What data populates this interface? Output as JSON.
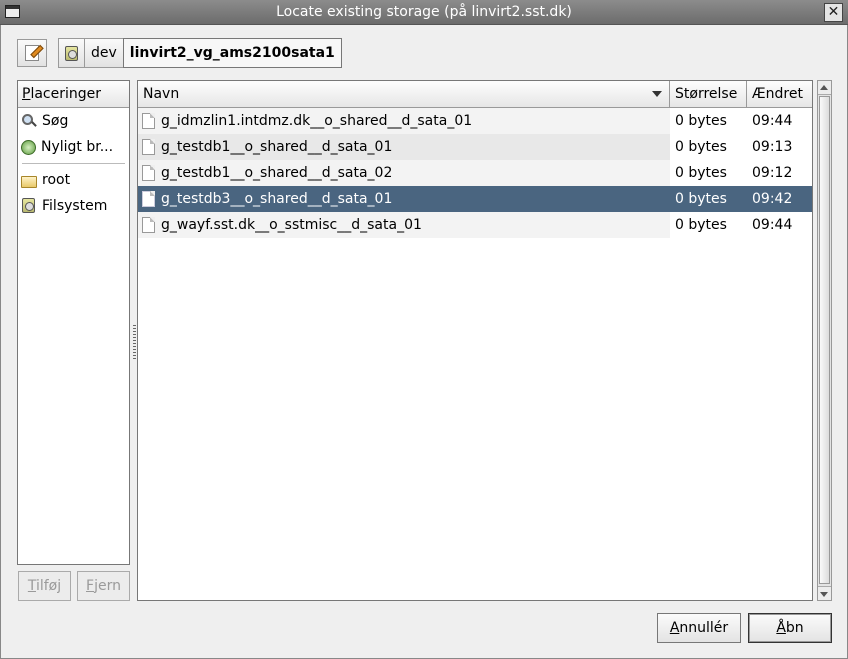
{
  "window": {
    "title": "Locate existing storage (på linvirt2.sst.dk)"
  },
  "path_bar": {
    "segments": [
      "dev",
      "linvirt2_vg_ams2100sata1"
    ]
  },
  "places": {
    "header_mnemonic": "P",
    "header_rest": "laceringer",
    "items": [
      {
        "label": "Søg",
        "icon": "search-icon"
      },
      {
        "label": "Nyligt br...",
        "icon": "recent-icon"
      },
      {
        "label": "root",
        "icon": "folder-icon"
      },
      {
        "label": "Filsystem",
        "icon": "drive-icon"
      }
    ],
    "add_button": {
      "mnemonic": "T",
      "rest": "ilføj"
    },
    "remove_button": {
      "mnemonic": "F",
      "rest": "jern"
    }
  },
  "files": {
    "columns": {
      "name": "Navn",
      "size": "Størrelse",
      "modified": "Ændret"
    },
    "rows": [
      {
        "name": "g_idmzlin1.intdmz.dk__o_shared__d_sata_01",
        "size": "0 bytes",
        "modified": "09:44"
      },
      {
        "name": "g_testdb1__o_shared__d_sata_01",
        "size": "0 bytes",
        "modified": "09:13"
      },
      {
        "name": "g_testdb1__o_shared__d_sata_02",
        "size": "0 bytes",
        "modified": "09:12"
      },
      {
        "name": "g_testdb3__o_shared__d_sata_01",
        "size": "0 bytes",
        "modified": "09:42",
        "selected": true
      },
      {
        "name": "g_wayf.sst.dk__o_sstmisc__d_sata_01",
        "size": "0 bytes",
        "modified": "09:44"
      }
    ]
  },
  "buttons": {
    "cancel": {
      "mnemonic": "A",
      "rest": "nnullér"
    },
    "open": {
      "mnemonic": "Å",
      "rest": "bn"
    }
  },
  "colors": {
    "selection": "#4a6580",
    "titlebar": "#7c7c7c"
  }
}
